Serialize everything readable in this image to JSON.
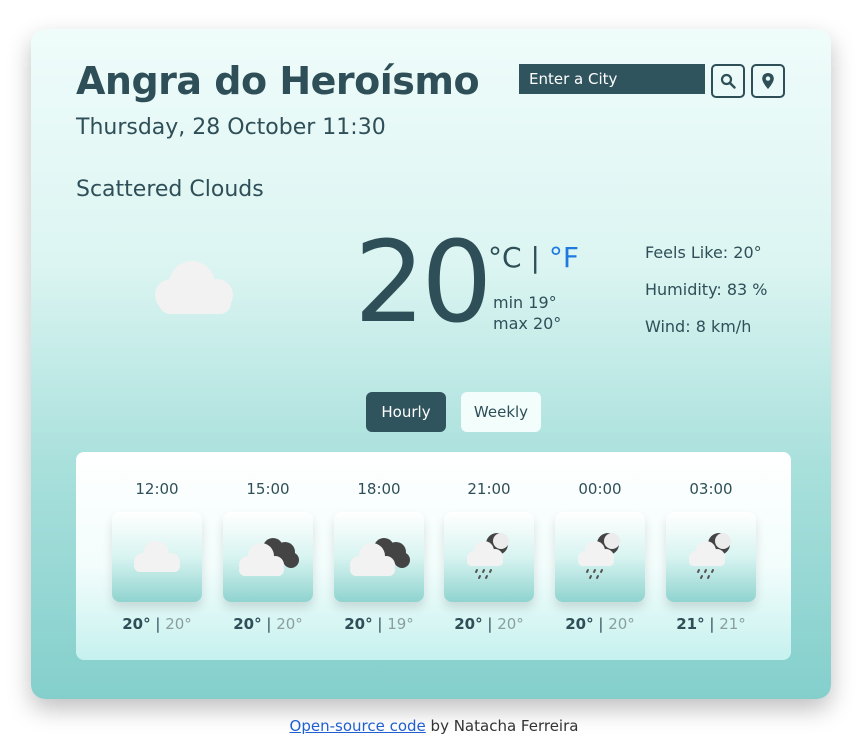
{
  "header": {
    "city": "Angra do Heroísmo",
    "datetime": "Thursday, 28 October 11:30"
  },
  "search": {
    "placeholder": "Enter a City",
    "search_icon": "search-icon",
    "location_icon": "location-pin-icon"
  },
  "current": {
    "description": "Scattered Clouds",
    "icon": "cloud-icon",
    "temperature": "20",
    "unit_c": "°C",
    "separator": "|",
    "unit_f": "°F",
    "min": "min 19°",
    "max": "max 20°",
    "feels_like": "Feels Like: 20°",
    "humidity": "Humidity: 83 %",
    "wind": "Wind: 8 km/h"
  },
  "tabs": {
    "hourly": "Hourly",
    "weekly": "Weekly"
  },
  "forecast": [
    {
      "time": "12:00",
      "hi": "20°",
      "lo": "20°",
      "icon": "cloud-icon"
    },
    {
      "time": "15:00",
      "hi": "20°",
      "lo": "20°",
      "icon": "broken-clouds-icon"
    },
    {
      "time": "18:00",
      "hi": "20°",
      "lo": "19°",
      "icon": "broken-clouds-icon"
    },
    {
      "time": "21:00",
      "hi": "20°",
      "lo": "20°",
      "icon": "night-rain-icon"
    },
    {
      "time": "00:00",
      "hi": "20°",
      "lo": "20°",
      "icon": "night-rain-icon"
    },
    {
      "time": "03:00",
      "hi": "21°",
      "lo": "21°",
      "icon": "night-rain-icon"
    }
  ],
  "footer": {
    "link_text": "Open-source code",
    "text": " by Natacha Ferreira"
  },
  "colors": {
    "accent_dark": "#2f545e",
    "text": "#2f4f58",
    "link_blue": "#1f7ae0"
  }
}
